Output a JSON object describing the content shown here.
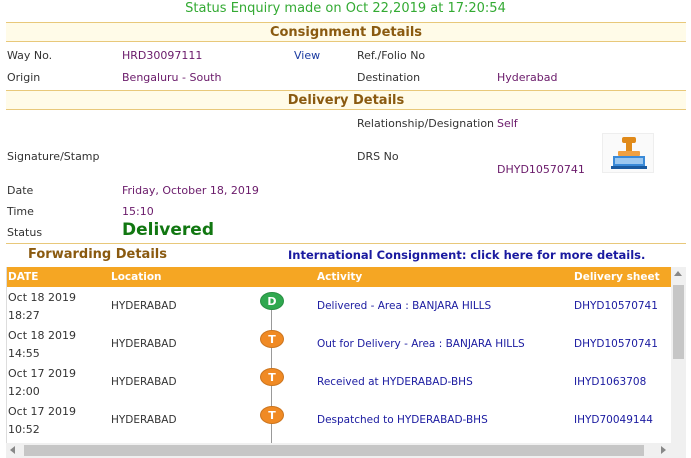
{
  "status_enquiry": "Status Enquiry made on Oct 22,2019 at 17:20:54",
  "consignment": {
    "title": "Consignment Details",
    "way_no_label": "Way No.",
    "way_no": "HRD30097111",
    "view_link": "View",
    "ref_folio_label": "Ref./Folio No",
    "ref_folio": "",
    "origin_label": "Origin",
    "origin": "Bengaluru - South",
    "destination_label": "Destination",
    "destination": "Hyderabad"
  },
  "delivery": {
    "title": "Delivery Details",
    "relationship_label": "Relationship/Designation",
    "relationship": "Self",
    "signature_label": "Signature/Stamp",
    "drs_label": "DRS No",
    "drs": "DHYD10570741",
    "date_label": "Date",
    "date": "Friday, October 18, 2019",
    "time_label": "Time",
    "time": "15:10",
    "status_label": "Status",
    "status": "Delivered",
    "stamp_icon": "rubber-stamp-icon"
  },
  "forwarding": {
    "title": "Forwarding Details",
    "intl_link": "International Consignment: click here for more details.",
    "columns": [
      "DATE",
      "Location",
      "Activity",
      "Delivery sheet"
    ],
    "rows": [
      {
        "date": "Oct 18 2019",
        "time": "18:27",
        "location": "HYDERABAD",
        "badge": "D",
        "badge_color": "#2fa84f",
        "activity": "Delivered - Area : BANJARA HILLS",
        "sheet": "DHYD10570741"
      },
      {
        "date": "Oct 18 2019",
        "time": "14:55",
        "location": "HYDERABAD",
        "badge": "T",
        "badge_color": "#f08a24",
        "activity": "Out for Delivery - Area : BANJARA HILLS",
        "sheet": "DHYD10570741"
      },
      {
        "date": "Oct 17 2019",
        "time": "12:00",
        "location": "HYDERABAD",
        "badge": "T",
        "badge_color": "#f08a24",
        "activity": "Received at HYDERABAD-BHS",
        "sheet": "IHYD1063708"
      },
      {
        "date": "Oct 17 2019",
        "time": "10:52",
        "location": "HYDERABAD",
        "badge": "T",
        "badge_color": "#f08a24",
        "activity": "Despatched to HYDERABAD-BHS",
        "sheet": "IHYD70049144"
      }
    ]
  }
}
